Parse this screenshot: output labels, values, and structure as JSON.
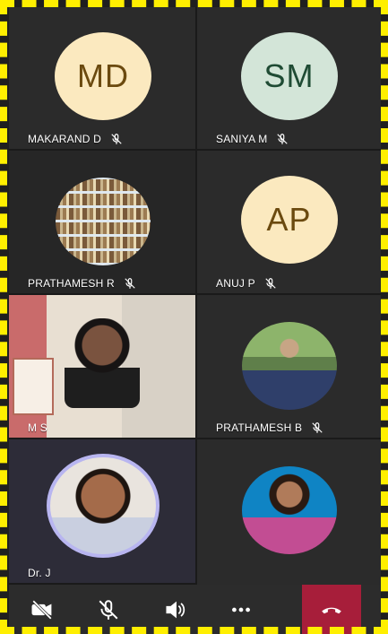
{
  "participants": [
    {
      "initials": "MD",
      "name": "MAKARAND D",
      "muted": true
    },
    {
      "initials": "SM",
      "name": "SANIYA M",
      "muted": true
    },
    {
      "initials": "",
      "name": "PRATHAMESH R",
      "muted": true
    },
    {
      "initials": "AP",
      "name": "ANUJ P",
      "muted": true
    },
    {
      "initials": "",
      "name": "M S",
      "muted": false
    },
    {
      "initials": "",
      "name": "PRATHAMESH B",
      "muted": true
    },
    {
      "initials": "",
      "name": "Dr. J",
      "muted": false
    },
    {
      "initials": "",
      "name": "",
      "muted": false
    }
  ],
  "toolbar": {
    "camera_icon": "video-off-icon",
    "mic_icon": "mic-off-icon",
    "speaker_icon": "speaker-icon",
    "more_icon": "more-horizontal-icon",
    "end_call_icon": "phone-hangup-icon"
  },
  "colors": {
    "frame_dash": "#ffef00",
    "end_call": "#a71e3a",
    "tile_bg": "#2b2b2b",
    "avatar_md": "#fbe9bf",
    "avatar_sm": "#d3e5d8"
  }
}
